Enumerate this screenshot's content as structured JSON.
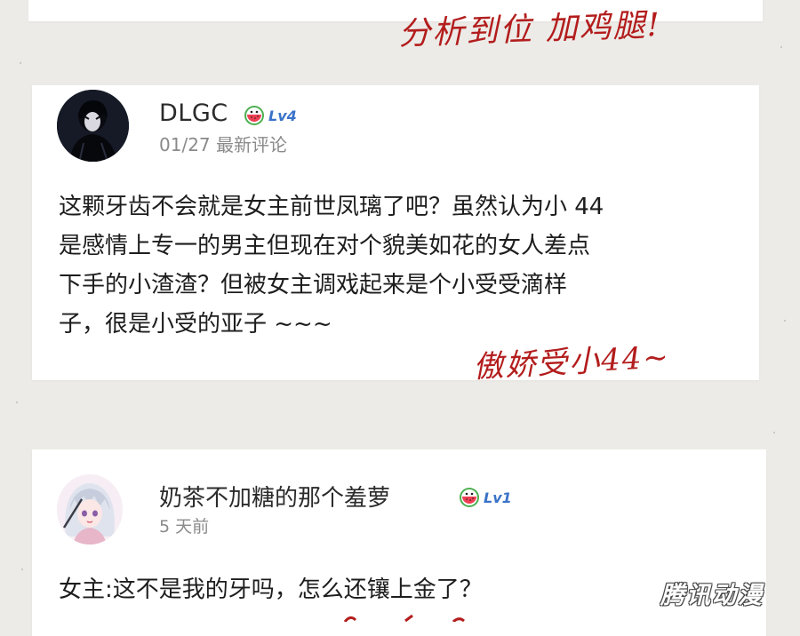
{
  "annotations": {
    "top": "分析到位 加鸡腿!",
    "middle": "傲娇受小44~"
  },
  "comments": [
    {
      "username": "DLGC",
      "level": "Lv4",
      "level_icon": "watermelon-level-icon",
      "meta": "01/27 最新评论",
      "body_lines": [
        "这颗牙齿不会就是女主前世凤璃了吧？虽然认为小 44",
        "是感情上专一的男主但现在对个貌美如花的女人差点",
        "下手的小渣渣？但被女主调戏起来是个小受受滴样",
        "子，很是小受的亚子 ~~~"
      ]
    },
    {
      "username": "奶茶不加糖的那个羞萝",
      "level": "Lv1",
      "level_icon": "watermelon-level-icon",
      "meta": "5 天前",
      "body": "女主:这不是我的牙吗，怎么还镶上金了？"
    }
  ],
  "watermark": "腾讯动漫",
  "colors": {
    "background": "#ecebe7",
    "annotation_red": "#b31d1d",
    "level_blue": "#3a73c8",
    "meta_gray": "#8a8a8a"
  }
}
